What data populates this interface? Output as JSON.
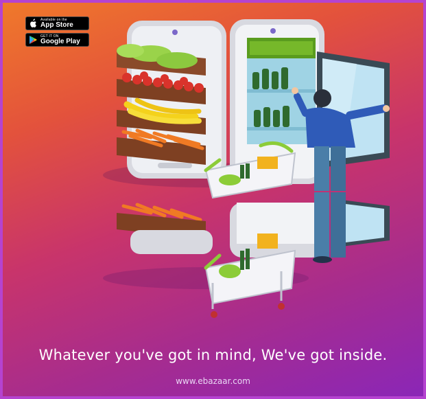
{
  "store_badges": {
    "apple": {
      "small": "Available on the",
      "big": "App Store"
    },
    "google": {
      "small": "GET IT ON",
      "big": "Google Play"
    }
  },
  "tagline": "Whatever you've got in mind, We've got inside.",
  "url": "www.ebazaar.com",
  "colors": {
    "gradient_start": "#f07a2a",
    "gradient_end": "#8a26b8",
    "fridge_green": "#76b82a",
    "frame": "#b543d0"
  },
  "icons": [
    "apple-icon",
    "google-play-icon"
  ]
}
